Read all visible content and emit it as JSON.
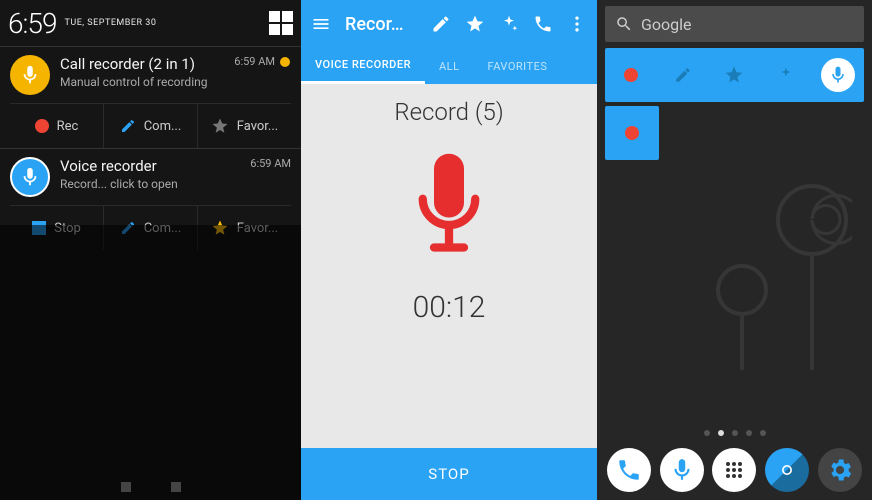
{
  "colors": {
    "accent": "#2aa3f4",
    "record": "#e62e2e",
    "favorite": "#ffc107"
  },
  "panel1": {
    "clock": "6:59",
    "date": "TUE, SEPTEMBER 30",
    "notifications": [
      {
        "icon": "mic-icon",
        "icon_bg": "#f5b400",
        "icon_fg": "#ffffff",
        "title": "Call recorder (2 in 1)",
        "subtitle": "Manual control of recording",
        "time": "6:59 AM",
        "actions": [
          {
            "icon": "record-dot",
            "label": "Rec"
          },
          {
            "icon": "pencil-icon",
            "label": "Com..."
          },
          {
            "icon": "star-icon",
            "label": "Favor...",
            "star_color": "#777"
          }
        ]
      },
      {
        "icon": "mic-icon",
        "icon_bg": "#2aa3f4",
        "icon_fg": "#ffffff",
        "title": "Voice recorder",
        "subtitle": "Record... click to open",
        "time": "6:59 AM",
        "actions": [
          {
            "icon": "stop-square",
            "label": "Stop"
          },
          {
            "icon": "pencil-icon",
            "label": "Com..."
          },
          {
            "icon": "star-icon",
            "label": "Favor...",
            "star_color": "#ffc107"
          }
        ]
      }
    ]
  },
  "panel2": {
    "appbar_title": "Recor…",
    "tabs": [
      "VOICE RECORDER",
      "ALL",
      "FAVORITES"
    ],
    "active_tab": 0,
    "record_title": "Record (5)",
    "timer": "00:12",
    "stop_label": "STOP"
  },
  "panel3": {
    "search_label": "Google",
    "widget_icons": [
      "record-dot",
      "pencil-icon",
      "star-icon",
      "sparkle-icon",
      "mic-circle-icon"
    ],
    "dock": [
      "phone-icon",
      "mic-app-icon",
      "apps-icon",
      "camera-icon",
      "settings-icon"
    ]
  }
}
